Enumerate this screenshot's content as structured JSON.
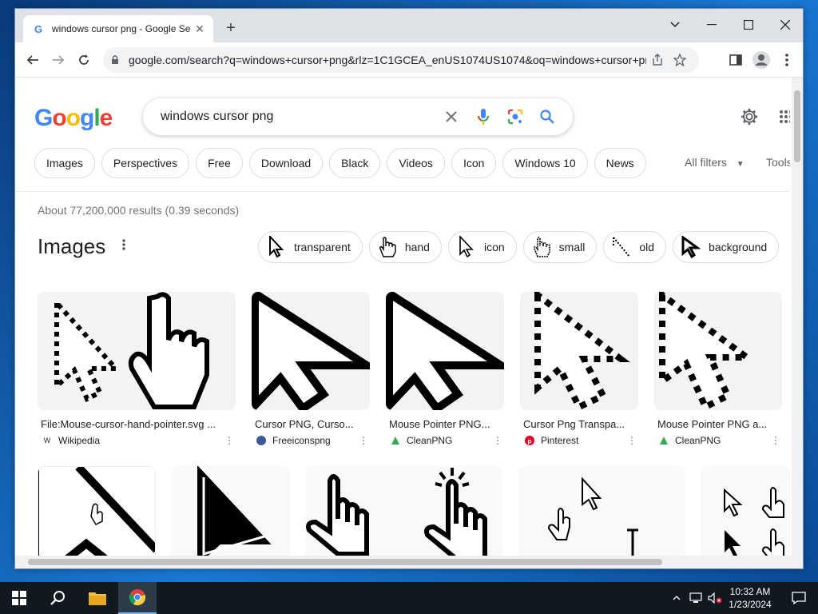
{
  "browser": {
    "tab_title": "windows cursor png - Google Se",
    "url": "google.com/search?q=windows+cursor+png&rlz=1C1GCEA_enUS1074US1074&oq=windows+cursor+pn..."
  },
  "search": {
    "query": "windows cursor png"
  },
  "filters": [
    "Images",
    "Perspectives",
    "Free",
    "Download",
    "Black",
    "Videos",
    "Icon",
    "Windows 10",
    "News"
  ],
  "all_filters_label": "All filters",
  "tools_label": "Tools",
  "results_count": "About 77,200,000 results (0.39 seconds)",
  "images_heading": "Images",
  "refine_chips": [
    "transparent",
    "hand",
    "icon",
    "small",
    "old",
    "background"
  ],
  "image_results": [
    {
      "title": "File:Mouse-cursor-hand-pointer.svg ...",
      "source": "Wikipedia"
    },
    {
      "title": "Cursor PNG, Curso...",
      "source": "Freeiconspng"
    },
    {
      "title": "Mouse Pointer PNG...",
      "source": "CleanPNG"
    },
    {
      "title": "Cursor Png Transpa...",
      "source": "Pinterest"
    },
    {
      "title": "Mouse Pointer PNG a...",
      "source": "CleanPNG"
    }
  ],
  "taskbar": {
    "time": "10:32 AM",
    "date": "1/23/2024"
  },
  "colors": {
    "google_blue": "#4285F4",
    "google_red": "#EA4335",
    "google_yellow": "#FBBC05",
    "google_green": "#34A853"
  }
}
